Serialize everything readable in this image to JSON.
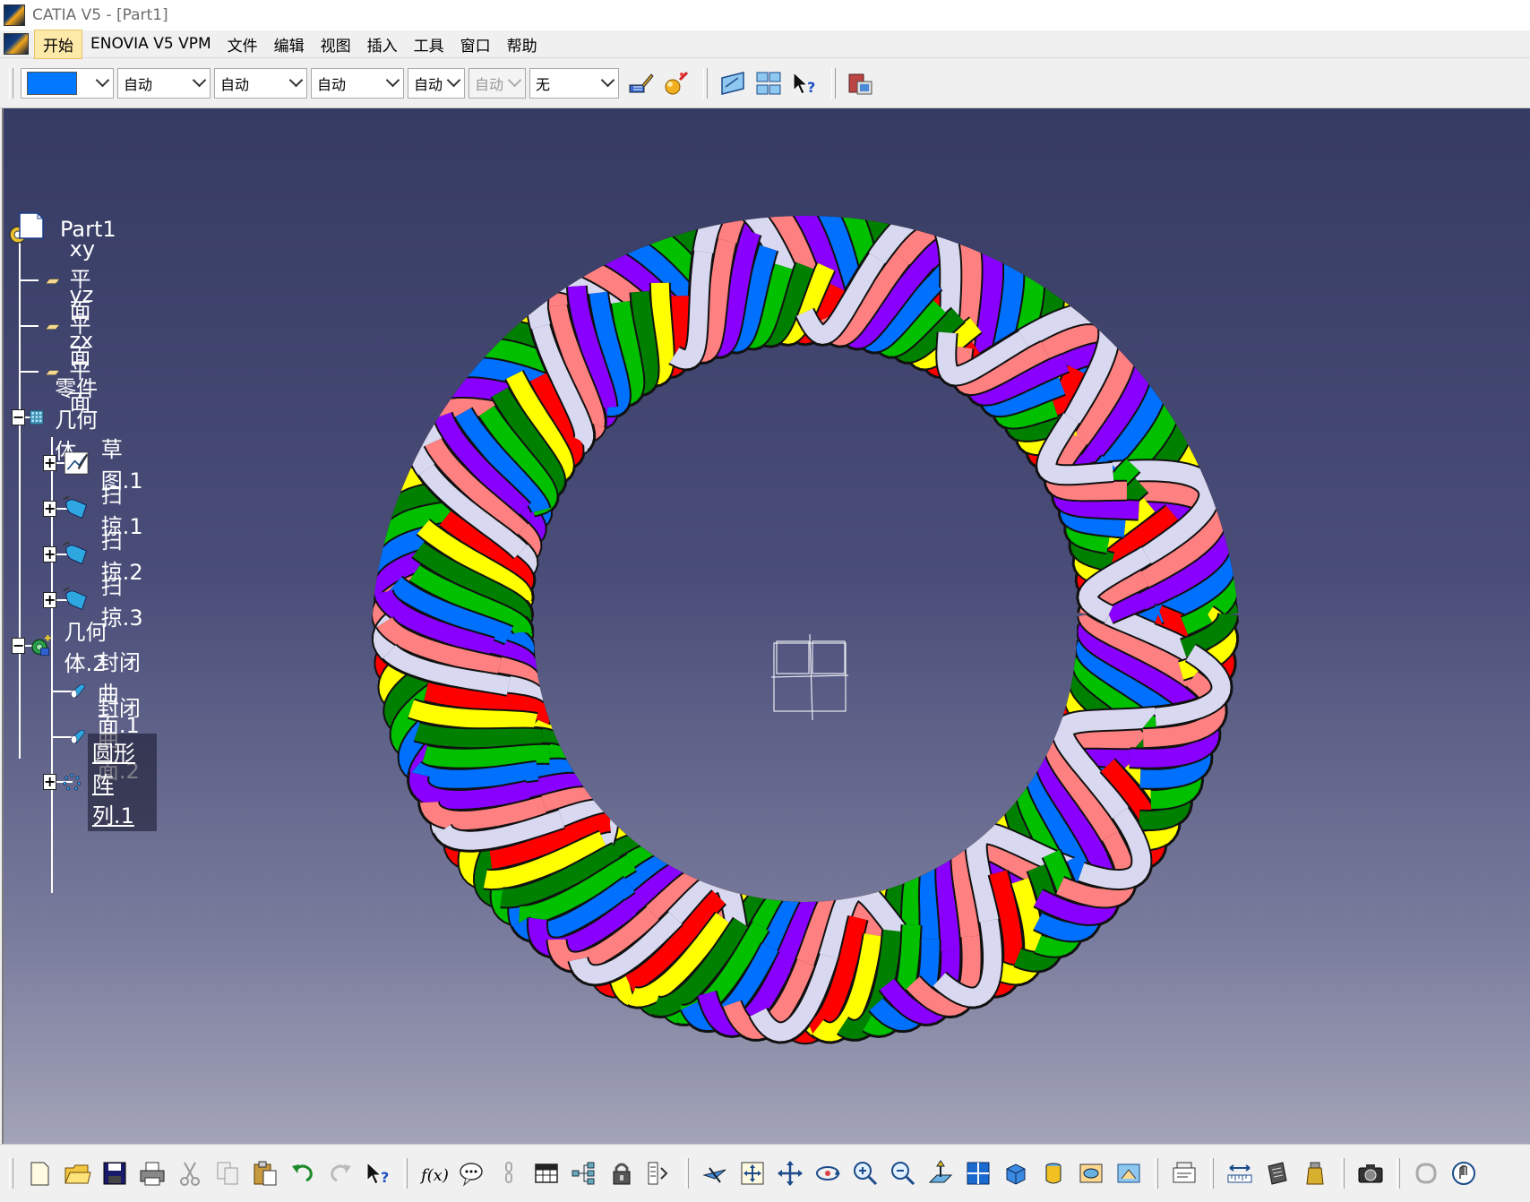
{
  "window": {
    "title": "CATIA V5 - [Part1]"
  },
  "menu": {
    "items": [
      "开始",
      "ENOVIA V5 VPM",
      "文件",
      "编辑",
      "视图",
      "插入",
      "工具",
      "窗口",
      "帮助"
    ]
  },
  "properties_toolbar": {
    "color_value": "#0078ff",
    "combos": [
      "自动",
      "自动",
      "自动",
      "自动",
      "自动",
      "无"
    ]
  },
  "tree": {
    "root": "Part1",
    "planes": [
      "xy 平面",
      "yz 平面",
      "zx 平面"
    ],
    "body1": "零件几何体",
    "body1_children": [
      "草图.1",
      "扫掠.1",
      "扫掠.2",
      "扫掠.3"
    ],
    "body2": "几何体.2",
    "body2_children": [
      "封闭曲面.1",
      "封闭曲面.2",
      "圆形阵列.1"
    ]
  },
  "model": {
    "colors": [
      "#ff0000",
      "#ffff00",
      "#008000",
      "#00c000",
      "#0070ff",
      "#8a00ff",
      "#ff8080",
      "#d8d8f0"
    ]
  }
}
